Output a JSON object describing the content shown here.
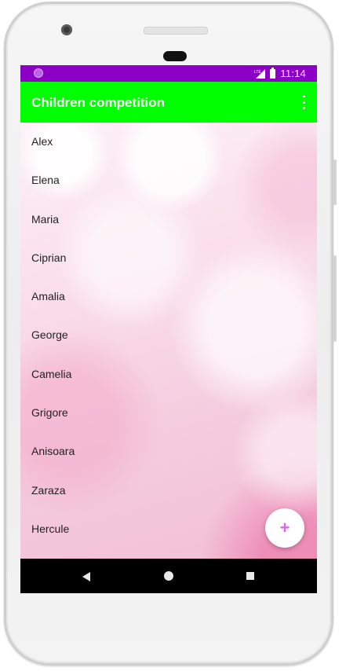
{
  "status_bar": {
    "time": "11:14",
    "network_label": "LTE",
    "icons": [
      "notification-dot-icon",
      "signal-icon",
      "battery-icon"
    ]
  },
  "app_bar": {
    "title": "Children competition",
    "overflow_icon": "more-vert-icon"
  },
  "children": [
    {
      "name": "Alex"
    },
    {
      "name": "Elena"
    },
    {
      "name": "Maria"
    },
    {
      "name": "Ciprian"
    },
    {
      "name": "Amalia"
    },
    {
      "name": "George"
    },
    {
      "name": "Camelia"
    },
    {
      "name": "Grigore"
    },
    {
      "name": "Anisoara"
    },
    {
      "name": "Zaraza"
    },
    {
      "name": "Hercule"
    }
  ],
  "fab": {
    "label": "+",
    "icon": "add-icon"
  },
  "nav_bar": {
    "icons": [
      "back-icon",
      "home-icon",
      "recents-icon"
    ]
  },
  "colors": {
    "status_bar": "#8b00c4",
    "app_bar": "#00ff00",
    "fab_icon": "#d766e8",
    "nav_bar": "#000000"
  }
}
